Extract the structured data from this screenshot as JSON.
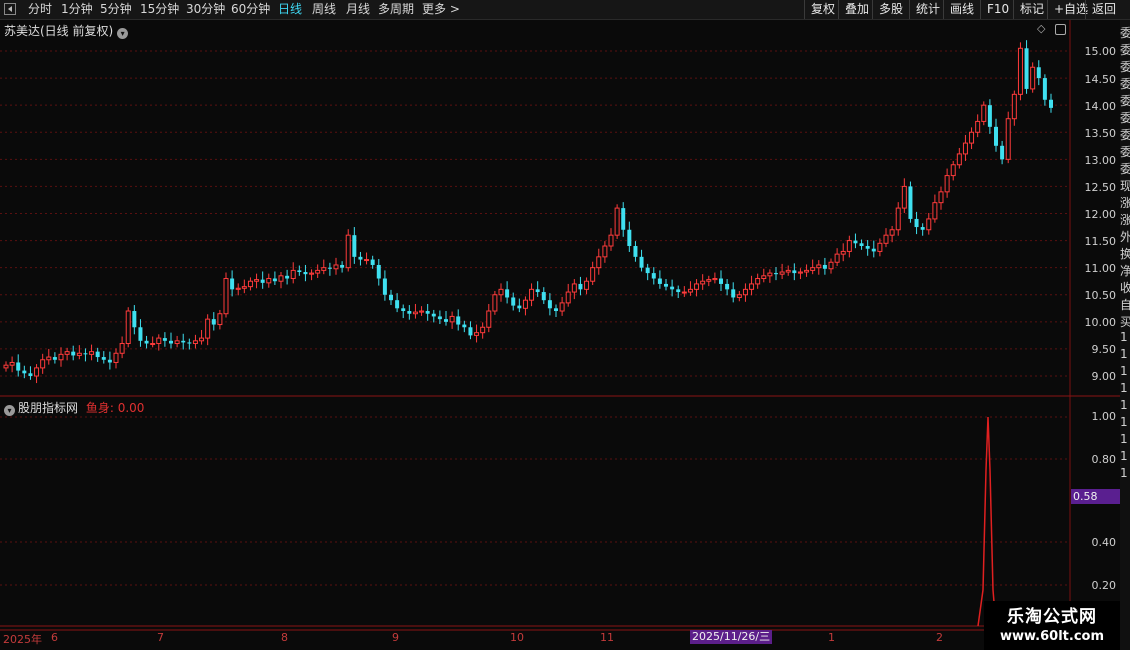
{
  "toolbar": {
    "periods": [
      "分时",
      "1分钟",
      "5分钟",
      "15分钟",
      "30分钟",
      "60分钟",
      "日线",
      "周线",
      "月线",
      "多周期",
      "更多 >"
    ],
    "active_period": "日线",
    "actions": [
      "复权",
      "叠加",
      "多股",
      "统计",
      "画线",
      "F10",
      "标记",
      "+自选",
      "返回"
    ]
  },
  "main_panel": {
    "title": "苏美达(日线 前复权)",
    "price_axis": [
      "15.00",
      "14.50",
      "14.00",
      "13.50",
      "13.00",
      "12.50",
      "12.00",
      "11.50",
      "11.00",
      "10.50",
      "10.00",
      "9.50",
      "9.00"
    ]
  },
  "indicator_panel": {
    "title": "股朋指标网",
    "field_label": "鱼身:",
    "field_value": "0.00",
    "axis": [
      "1.00",
      "0.80",
      "0.40",
      "0.20"
    ],
    "cursor_value": "0.58"
  },
  "time_axis": {
    "labels": [
      "2025年",
      "6",
      "7",
      "8",
      "9",
      "10",
      "11",
      "1",
      "2"
    ],
    "highlighted_date": "2025/11/26/三"
  },
  "right_strip": {
    "chars": [
      "委",
      "委",
      "委",
      "委",
      "委",
      "委",
      "委",
      "委",
      "委",
      "现",
      "涨",
      "涨",
      "外",
      "换",
      "净",
      "收",
      "自",
      "买",
      "1",
      "1",
      "1",
      "1",
      "1",
      "1",
      "1",
      "1",
      "1"
    ]
  },
  "watermark": {
    "title": "乐淘公式网",
    "url": "www.60lt.com"
  },
  "colors": {
    "up": "#ff3b3b",
    "down": "#3fe0f0",
    "background": "#0a0a0a",
    "grid": "#5a1010",
    "indicator_line": "#e02020"
  },
  "chart_data": {
    "type": "candlestick",
    "title": "苏美达(日线 前复权)",
    "ylim": [
      8.8,
      15.25
    ],
    "closes": [
      9.2,
      9.25,
      9.1,
      9.05,
      9.0,
      9.15,
      9.3,
      9.35,
      9.3,
      9.4,
      9.45,
      9.38,
      9.42,
      9.4,
      9.45,
      9.35,
      9.3,
      9.25,
      9.42,
      9.6,
      10.2,
      9.9,
      9.65,
      9.6,
      9.6,
      9.7,
      9.65,
      9.6,
      9.65,
      9.62,
      9.6,
      9.65,
      9.7,
      10.05,
      9.95,
      10.15,
      10.8,
      10.6,
      10.62,
      10.65,
      10.75,
      10.78,
      10.72,
      10.8,
      10.75,
      10.85,
      10.8,
      10.95,
      10.92,
      10.88,
      10.9,
      10.95,
      11.0,
      10.98,
      11.05,
      11.0,
      11.6,
      11.2,
      11.15,
      11.15,
      11.05,
      10.8,
      10.5,
      10.4,
      10.25,
      10.2,
      10.15,
      10.18,
      10.2,
      10.15,
      10.1,
      10.05,
      10.0,
      10.1,
      9.95,
      9.9,
      9.75,
      9.8,
      9.9,
      10.2,
      10.5,
      10.6,
      10.45,
      10.3,
      10.25,
      10.4,
      10.6,
      10.55,
      10.4,
      10.25,
      10.2,
      10.35,
      10.55,
      10.7,
      10.6,
      10.75,
      11.0,
      11.2,
      11.4,
      11.6,
      12.1,
      11.7,
      11.4,
      11.2,
      11.0,
      10.9,
      10.8,
      10.7,
      10.65,
      10.6,
      10.55,
      10.55,
      10.6,
      10.7,
      10.75,
      10.78,
      10.8,
      10.7,
      10.6,
      10.45,
      10.5,
      10.6,
      10.7,
      10.8,
      10.85,
      10.9,
      10.88,
      10.92,
      10.95,
      10.9,
      10.92,
      10.95,
      11.0,
      11.05,
      10.98,
      11.1,
      11.25,
      11.3,
      11.5,
      11.45,
      11.4,
      11.35,
      11.3,
      11.45,
      11.6,
      11.7,
      12.1,
      12.5,
      11.9,
      11.75,
      11.7,
      11.9,
      12.2,
      12.4,
      12.7,
      12.9,
      13.1,
      13.3,
      13.5,
      13.7,
      14.0,
      13.6,
      13.25,
      13.0,
      13.75,
      14.2,
      15.05,
      14.3,
      14.7,
      14.5,
      14.1,
      13.95
    ]
  }
}
